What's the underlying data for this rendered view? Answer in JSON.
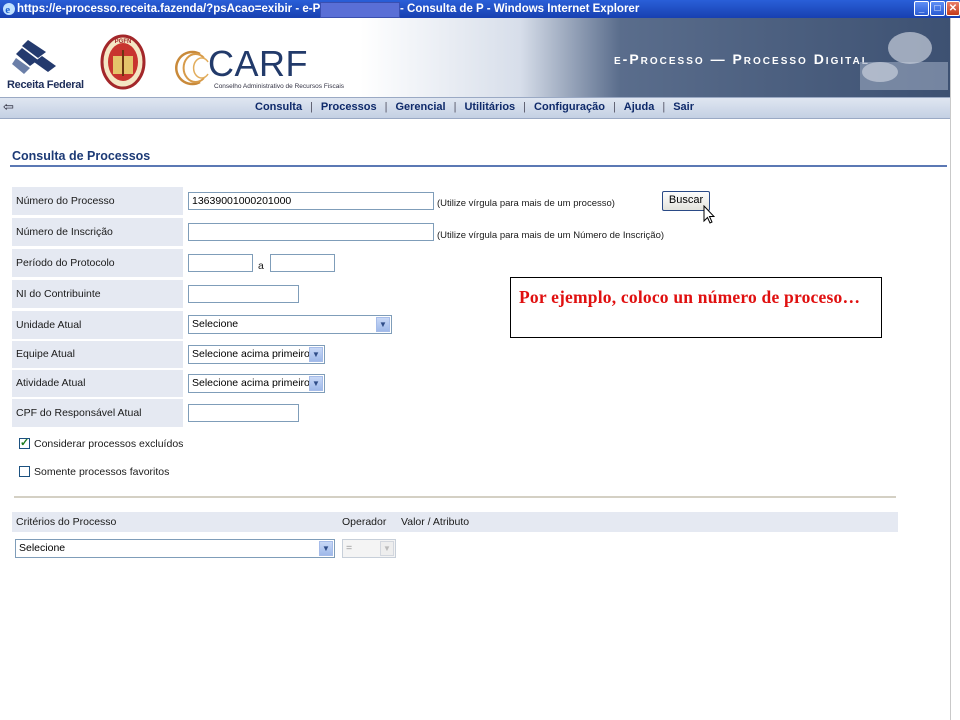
{
  "window": {
    "title_left": "https://e-processo.receita.fazenda/?psAcao=exibir - e-Processo -",
    "title_right": "- Consulta de P - Windows Internet Explorer",
    "minimize": "_",
    "maximize": "□",
    "close": "✕"
  },
  "header": {
    "receita_federal": "Receita Federal",
    "pgfn": "PGFN",
    "carf": "CARF",
    "carf_sub": "Conselho Administrativo de Recursos Fiscais",
    "eprocesso": "e-Processo  —  Processo Digital"
  },
  "nav": {
    "back": "⇦",
    "items": [
      "Consulta",
      "Processos",
      "Gerencial",
      "Utilitários",
      "Configuração",
      "Ajuda",
      "Sair"
    ],
    "separator": "|"
  },
  "page": {
    "title": "Consulta de Processos"
  },
  "form": {
    "numero_processo": {
      "label": "Número do Processo",
      "value": "13639001000201000",
      "hint": "(Utilize vírgula para mais de um processo)"
    },
    "numero_inscricao": {
      "label": "Número de Inscrição",
      "value": "",
      "hint": "(Utilize vírgula para mais de um Número de Inscrição)"
    },
    "periodo": {
      "label": "Período do Protocolo",
      "separator": "a",
      "from": "",
      "to": ""
    },
    "ni": {
      "label": "NI do Contribuinte",
      "value": ""
    },
    "unidade": {
      "label": "Unidade Atual",
      "selected": "Selecione"
    },
    "equipe": {
      "label": "Equipe Atual",
      "selected": "Selecione acima primeiro"
    },
    "atividade": {
      "label": "Atividade Atual",
      "selected": "Selecione acima primeiro"
    },
    "cpf": {
      "label": "CPF do Responsável Atual",
      "value": ""
    },
    "buscar": "Buscar",
    "chk_excluidos": {
      "label": "Considerar processos excluídos",
      "checked": true,
      "mark": "✓"
    },
    "chk_favoritos": {
      "label": "Somente processos favoritos",
      "checked": false
    }
  },
  "criteria": {
    "col_criterios": "Critérios do Processo",
    "col_operador": "Operador",
    "col_valor": "Valor / Atributo",
    "criterio_selected": "Selecione",
    "operador_selected": "="
  },
  "annotation": {
    "text": "Por ejemplo, coloco un número de proceso…",
    "color": "#e01010"
  }
}
